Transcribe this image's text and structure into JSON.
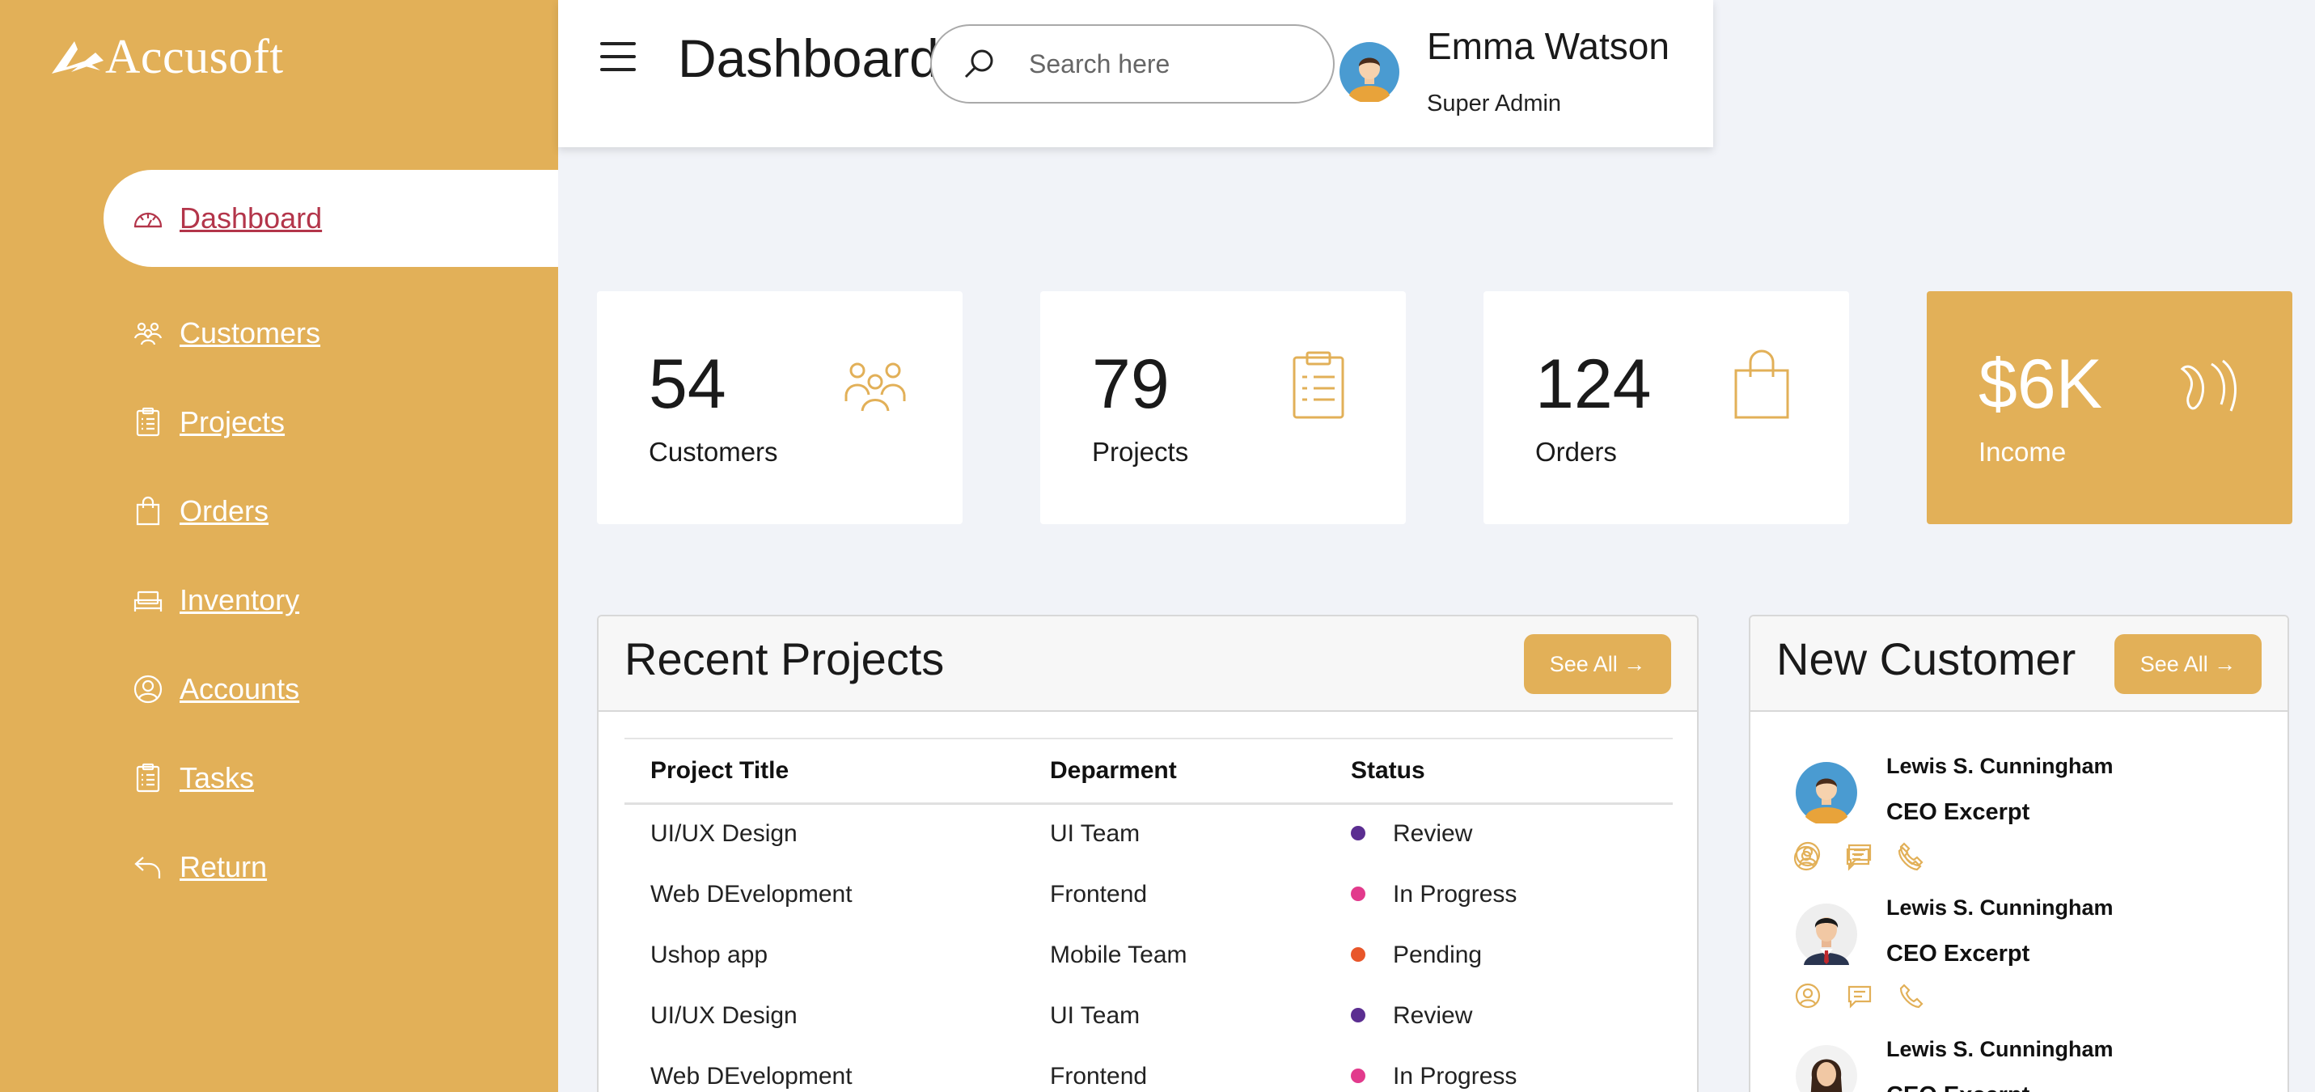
{
  "app": {
    "brand": "Accusoft"
  },
  "sidebar": {
    "items": [
      {
        "label": "Dashboard",
        "icon": "dashboard-gauge-icon",
        "active": true
      },
      {
        "label": "Customers",
        "icon": "people-icon"
      },
      {
        "label": "Projects",
        "icon": "clipboard-icon"
      },
      {
        "label": "Orders",
        "icon": "shopping-bag-icon"
      },
      {
        "label": "Inventory",
        "icon": "inventory-icon"
      },
      {
        "label": "Accounts",
        "icon": "user-circle-icon"
      },
      {
        "label": "Tasks",
        "icon": "task-clipboard-icon"
      },
      {
        "label": "Return",
        "icon": "return-arrow-icon"
      }
    ]
  },
  "header": {
    "title": "Dashboard",
    "search_placeholder": "Search here",
    "user_name": "Emma Watson",
    "user_role": "Super Admin"
  },
  "cards": [
    {
      "value": "54",
      "label": "Customers",
      "icon": "people-icon"
    },
    {
      "value": "79",
      "label": "Projects",
      "icon": "clipboard-icon"
    },
    {
      "value": "124",
      "label": "Orders",
      "icon": "shopping-bag-icon"
    },
    {
      "value": "$6K",
      "label": "Income",
      "icon": "income-icon"
    }
  ],
  "recent_projects": {
    "title": "Recent Projects",
    "see_all": "See All →",
    "columns": [
      "Project Title",
      "Deparment",
      "Status"
    ],
    "rows": [
      {
        "title": "UI/UX Design",
        "department": "UI Team",
        "status": "Review",
        "status_color": "#5b2e91"
      },
      {
        "title": "Web DEvelopment",
        "department": "Frontend",
        "status": "In Progress",
        "status_color": "#e23a8c"
      },
      {
        "title": "Ushop app",
        "department": "Mobile Team",
        "status": "Pending",
        "status_color": "#e8562a"
      },
      {
        "title": "UI/UX Design",
        "department": "UI Team",
        "status": "Review",
        "status_color": "#5b2e91"
      },
      {
        "title": "Web DEvelopment",
        "department": "Frontend",
        "status": "In Progress",
        "status_color": "#e23a8c"
      }
    ]
  },
  "new_customer": {
    "title": "New Customer",
    "see_all": "See All →",
    "customers": [
      {
        "name": "Lewis S. Cunningham",
        "role": "CEO Excerpt",
        "avatar": "man-avatar-blue-icon"
      },
      {
        "name": "Lewis S. Cunningham",
        "role": "CEO Excerpt",
        "avatar": "man-suit-avatar-icon"
      },
      {
        "name": "Lewis S. Cunningham",
        "role": "CEO Excerpt",
        "avatar": "woman-avatar-icon"
      }
    ]
  },
  "colors": {
    "accent": "#e2b058",
    "active_text": "#b3354a"
  }
}
